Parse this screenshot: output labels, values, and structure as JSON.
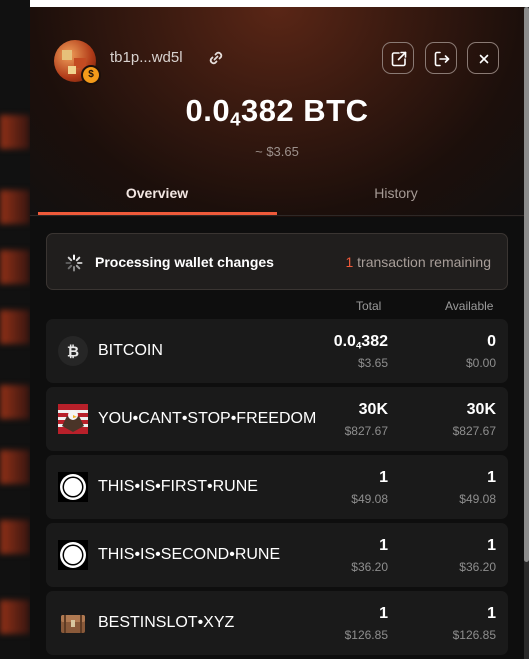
{
  "wallet": {
    "address": "tb1p...wd5l",
    "balance_prefix": "0.0",
    "balance_sub": "4",
    "balance_rest": "382 BTC",
    "balance_usd": "~ $3.65"
  },
  "tabs": [
    {
      "label": "Overview",
      "active": true
    },
    {
      "label": "History",
      "active": false
    }
  ],
  "status": {
    "text": "Processing wallet changes",
    "count": "1",
    "suffix": " transaction remaining"
  },
  "columns": {
    "total": "Total",
    "available": "Available"
  },
  "assets": [
    {
      "name": "BITCOIN",
      "total_prefix": "0.0",
      "total_sub": "4",
      "total_rest": "382",
      "total_usd": "$3.65",
      "available": "0",
      "available_usd": "$0.00"
    },
    {
      "name": "YOU•CANT•STOP•FREEDOM",
      "total": "30K",
      "total_usd": "$827.67",
      "available": "30K",
      "available_usd": "$827.67"
    },
    {
      "name": "THIS•IS•FIRST•RUNE",
      "total": "1",
      "total_usd": "$49.08",
      "available": "1",
      "available_usd": "$49.08"
    },
    {
      "name": "THIS•IS•SECOND•RUNE",
      "total": "1",
      "total_usd": "$36.20",
      "available": "1",
      "available_usd": "$36.20"
    },
    {
      "name": "BESTINSLOT•XYZ",
      "total": "1",
      "total_usd": "$126.85",
      "available": "1",
      "available_usd": "$126.85"
    }
  ],
  "colors": {
    "accent": "#ef5a3a",
    "bitcoin_badge": "#f39a1a"
  },
  "icons": [
    "copy-icon",
    "external-link-icon",
    "logout-icon",
    "close-icon",
    "spinner-icon",
    "bitcoin-icon"
  ]
}
